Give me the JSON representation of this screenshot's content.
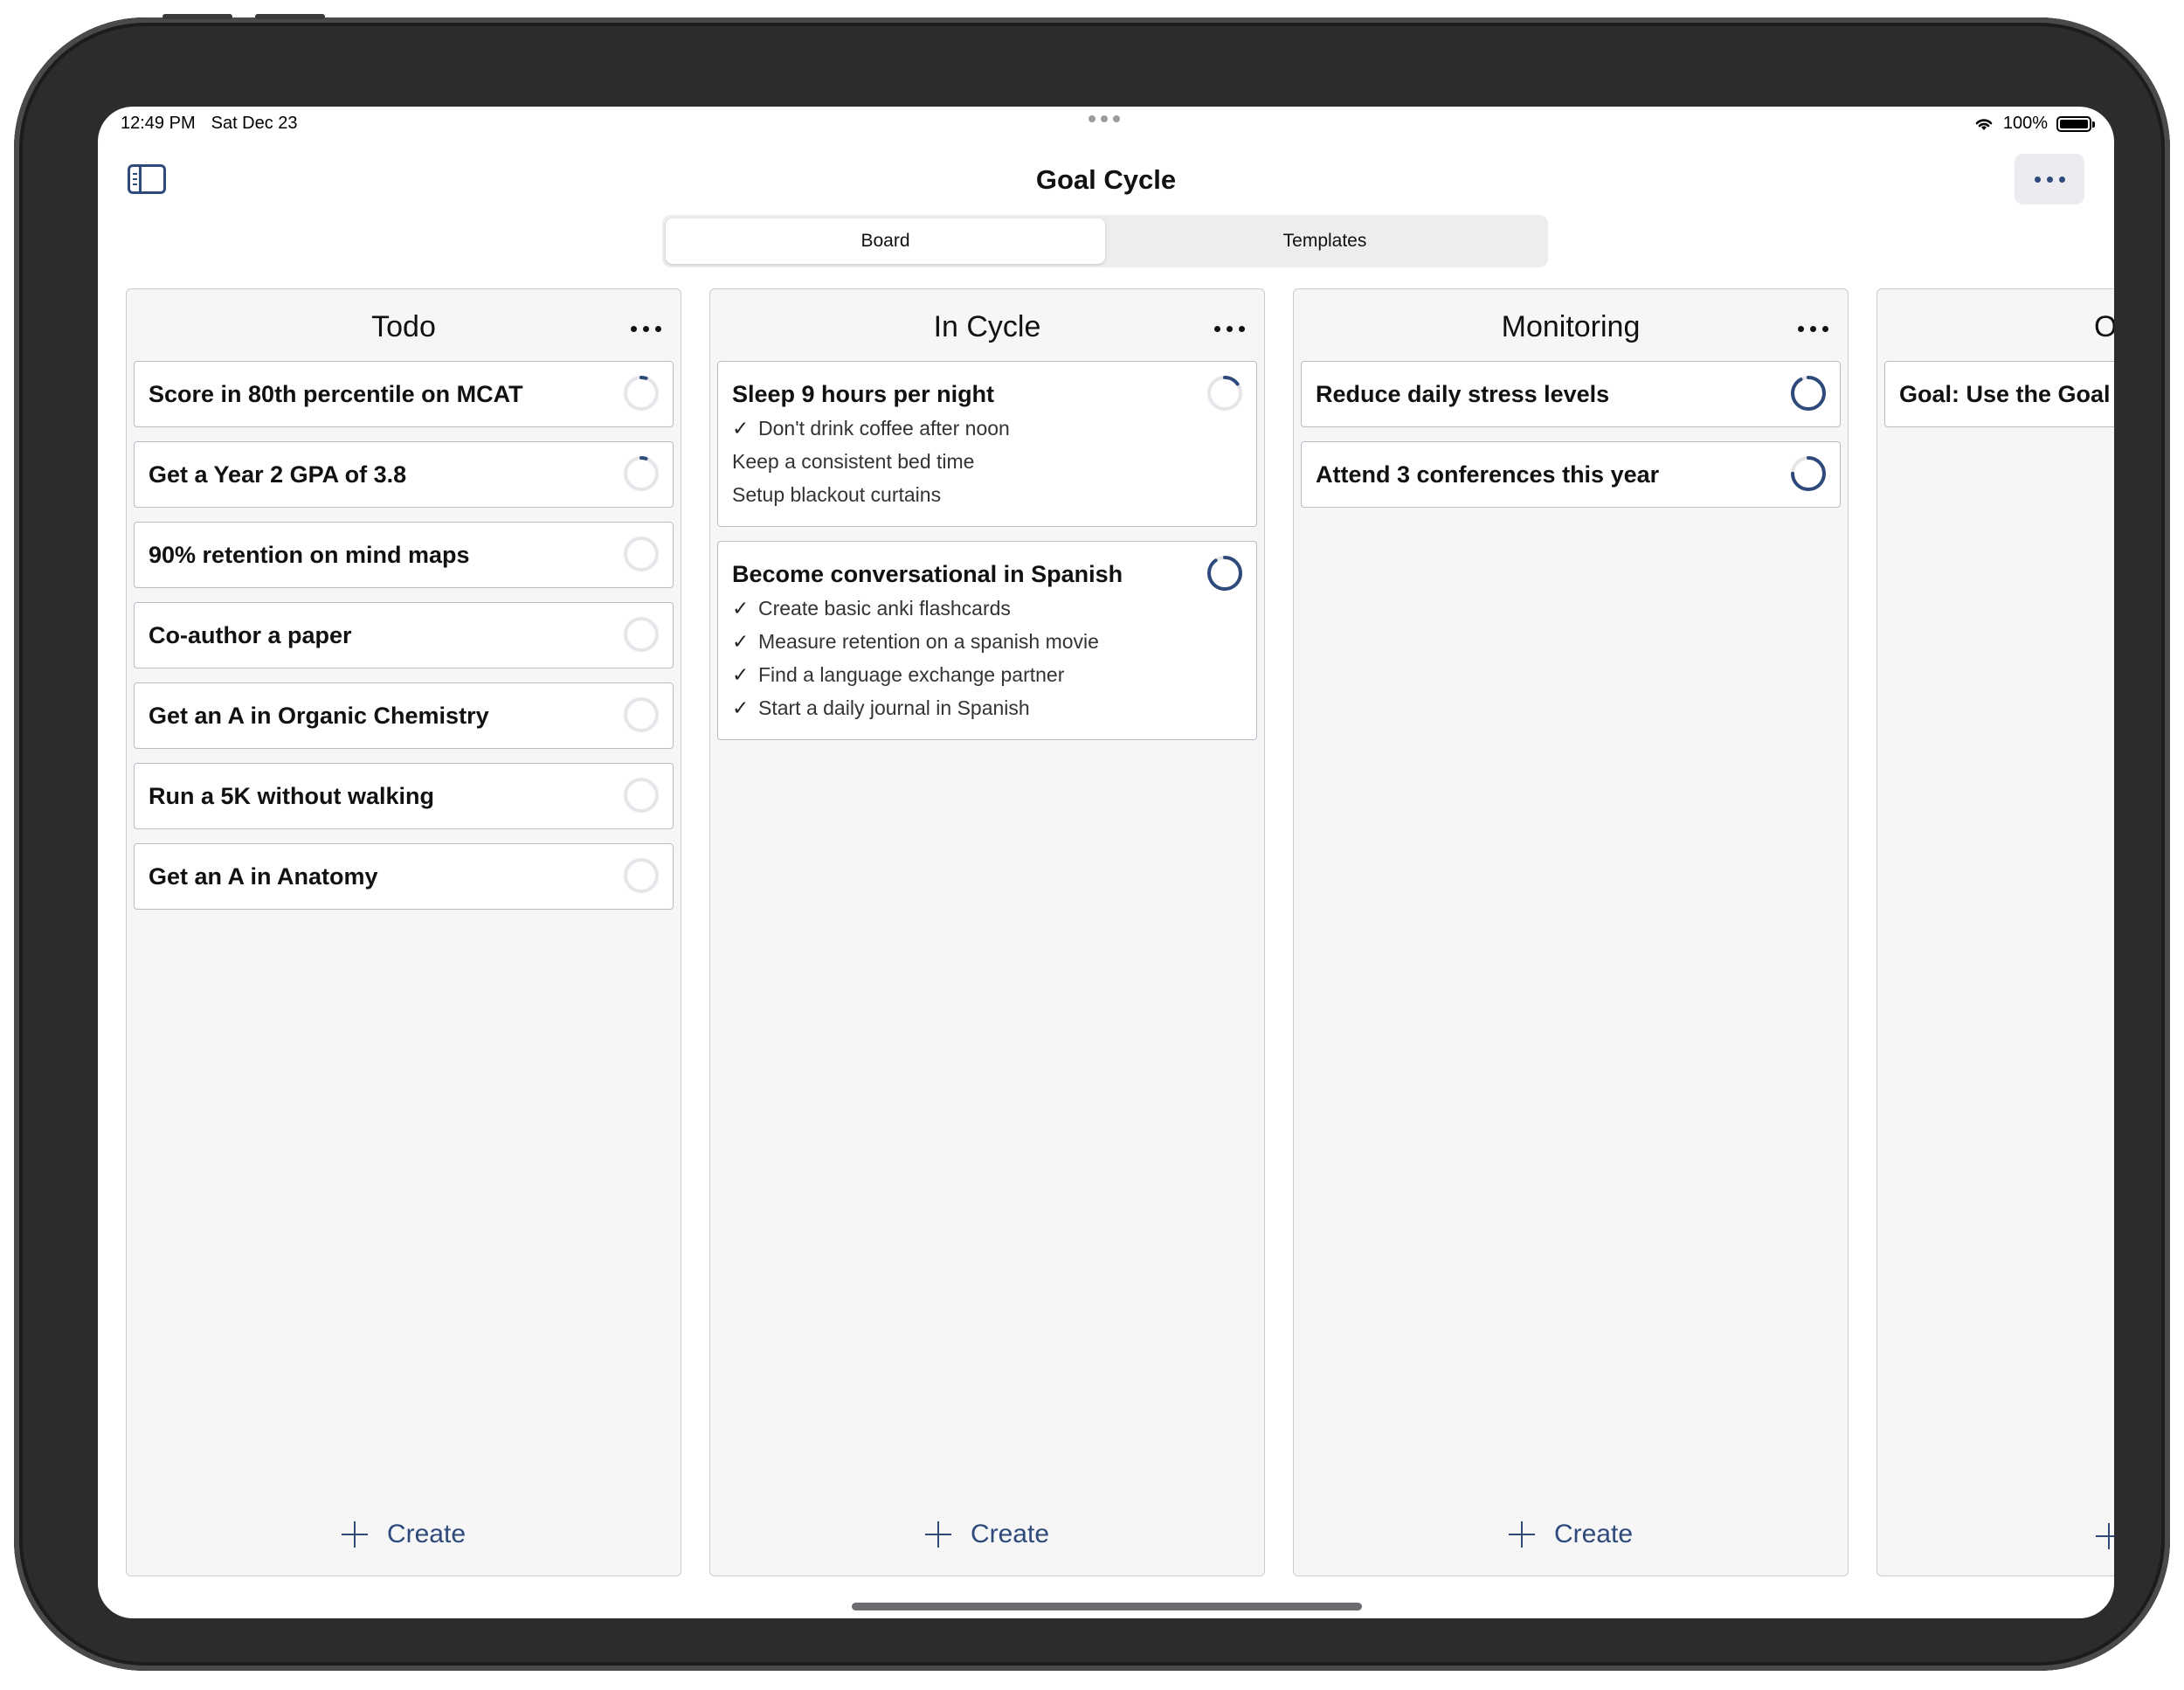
{
  "status": {
    "time": "12:49 PM",
    "date": "Sat Dec 23",
    "battery": "100%"
  },
  "header": {
    "title": "Goal Cycle"
  },
  "tabs": [
    {
      "label": "Board",
      "active": true
    },
    {
      "label": "Templates",
      "active": false
    }
  ],
  "columns": [
    {
      "title": "Todo",
      "create_label": "Create",
      "cards": [
        {
          "title": "Score in 80th percentile on MCAT",
          "progress": 0.05,
          "items": []
        },
        {
          "title": "Get a Year 2 GPA of 3.8",
          "progress": 0.05,
          "items": []
        },
        {
          "title": "90% retention on mind maps",
          "progress": 0,
          "items": []
        },
        {
          "title": "Co-author a paper",
          "progress": 0,
          "items": []
        },
        {
          "title": "Get an A in Organic Chemistry",
          "progress": 0,
          "items": []
        },
        {
          "title": "Run a 5K without walking",
          "progress": 0,
          "items": []
        },
        {
          "title": "Get an A in Anatomy",
          "progress": 0,
          "items": []
        }
      ]
    },
    {
      "title": "In Cycle",
      "create_label": "Create",
      "cards": [
        {
          "title": "Sleep 9 hours per night",
          "progress": 0.15,
          "items": [
            {
              "text": "Don't drink coffee after noon",
              "done": true
            },
            {
              "text": "Keep a consistent bed time",
              "done": false
            },
            {
              "text": "Setup blackout curtains",
              "done": false
            }
          ]
        },
        {
          "title": "Become conversational in Spanish",
          "progress": 0.9,
          "items": [
            {
              "text": "Create basic anki flashcards",
              "done": true
            },
            {
              "text": "Measure retention on a spanish movie",
              "done": true
            },
            {
              "text": "Find a language exchange partner",
              "done": true
            },
            {
              "text": "Start a daily journal in Spanish",
              "done": true
            }
          ]
        }
      ]
    },
    {
      "title": "Monitoring",
      "create_label": "Create",
      "cards": [
        {
          "title": "Reduce daily stress levels",
          "progress": 0.92,
          "items": []
        },
        {
          "title": "Attend 3 conferences this year",
          "progress": 0.75,
          "items": []
        }
      ]
    },
    {
      "title": "Outcome",
      "create_label": "",
      "cards": [
        {
          "title": "Goal: Use the Goal Cycle",
          "progress": 0,
          "items": []
        }
      ]
    }
  ],
  "colors": {
    "accent": "#2e4a7a",
    "ring_track": "#e6e6ea"
  }
}
